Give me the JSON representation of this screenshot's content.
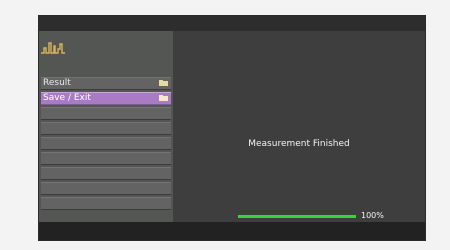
{
  "menu": {
    "items": [
      {
        "label": "Result",
        "icon": "folder-icon",
        "selected": false
      },
      {
        "label": "Save / Exit",
        "icon": "folder-icon",
        "selected": true
      },
      {
        "label": "",
        "icon": "",
        "selected": false
      },
      {
        "label": "",
        "icon": "",
        "selected": false
      },
      {
        "label": "",
        "icon": "",
        "selected": false
      },
      {
        "label": "",
        "icon": "",
        "selected": false
      },
      {
        "label": "",
        "icon": "",
        "selected": false
      },
      {
        "label": "",
        "icon": "",
        "selected": false
      },
      {
        "label": "",
        "icon": "",
        "selected": false
      }
    ]
  },
  "status": {
    "message": "Measurement Finished"
  },
  "progress": {
    "label": "100%",
    "fraction": 1.0
  },
  "colors": {
    "selected_row": "#a97bc5",
    "progress": "#39d43a",
    "logo": "#d9b35a"
  }
}
